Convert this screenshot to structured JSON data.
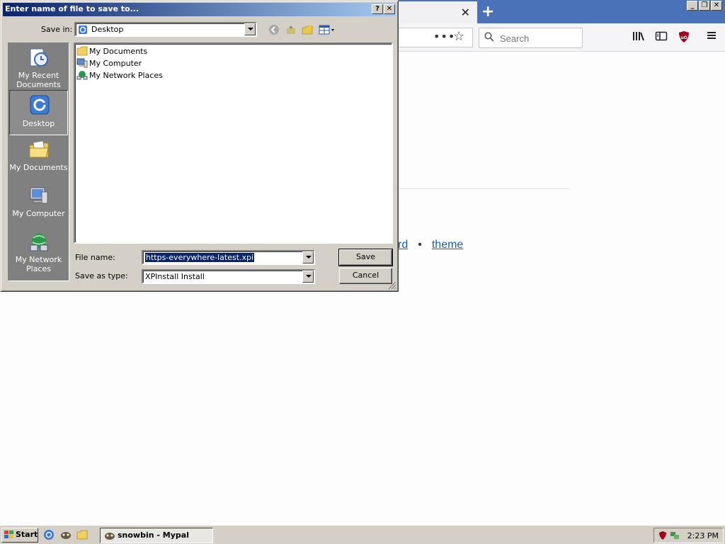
{
  "browser": {
    "active_tab_close": "✕",
    "new_tab": "+",
    "url_more": "•••",
    "search_placeholder": "Search",
    "page_links": {
      "partial_link": "rd",
      "separator": "•",
      "theme_link": "theme"
    },
    "icons": [
      "bookmark-star-icon",
      "search-icon",
      "library-icon",
      "sidebar-icon",
      "ublock-icon",
      "hamburger-menu-icon"
    ]
  },
  "dialog": {
    "title": "Enter name of file to save to...",
    "help_button": "?",
    "close_button": "✕",
    "save_in_label": "Save in:",
    "save_in_value": "Desktop",
    "places": [
      {
        "label": "My Recent Documents",
        "icon": "recent-documents-icon"
      },
      {
        "label": "Desktop",
        "icon": "desktop-icon",
        "selected": true
      },
      {
        "label": "My Documents",
        "icon": "my-documents-icon"
      },
      {
        "label": "My Computer",
        "icon": "my-computer-icon"
      },
      {
        "label": "My Network Places",
        "icon": "network-places-icon"
      }
    ],
    "files": [
      {
        "name": "My Documents",
        "icon": "folder-icon"
      },
      {
        "name": "My Computer",
        "icon": "computer-icon"
      },
      {
        "name": "My Network Places",
        "icon": "network-icon"
      }
    ],
    "file_name_label": "File name:",
    "file_name_value": "https-everywhere-latest.xpi",
    "save_as_type_label": "Save as type:",
    "save_as_type_value": "XPInstall Install",
    "save_button": "Save",
    "cancel_button": "Cancel"
  },
  "taskbar": {
    "start_label": "Start",
    "task_button": "snowbin - Mypal",
    "clock": "2:23 PM"
  },
  "colors": {
    "title_gradient_start": "#0a246a",
    "title_gradient_end": "#a6caf0",
    "dialog_face": "#d4d0c8",
    "places_bg": "#808080",
    "browser_tabbar": "#4a72b8",
    "link": "#1a5fb4"
  }
}
